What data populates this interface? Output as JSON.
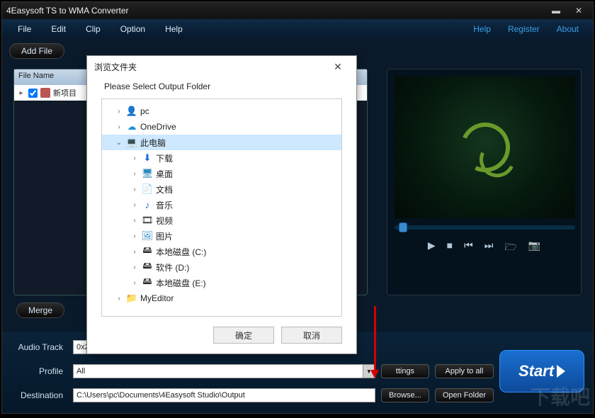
{
  "window": {
    "title": "4Easysoft TS to WMA Converter"
  },
  "menu": {
    "items": [
      "File",
      "Edit",
      "Clip",
      "Option",
      "Help"
    ],
    "right": [
      "Help",
      "Register",
      "About"
    ]
  },
  "toolbar": {
    "add_file": "Add File"
  },
  "file_list": {
    "header": "File Name",
    "item0_label": "新项目"
  },
  "buttons": {
    "merge": "Merge",
    "apply_all": "Apply to all",
    "browse": "Browse...",
    "open_folder": "Open Folder",
    "start": "Start",
    "settings_fragment": "ttings"
  },
  "labels": {
    "audio_track": "Audio Track",
    "profile": "Profile",
    "destination": "Destination"
  },
  "fields": {
    "audio_track_value": "0x2",
    "profile_value": "All",
    "destination_value": "C:\\Users\\pc\\Documents\\4Easysoft Studio\\Output"
  },
  "dialog": {
    "title": "浏览文件夹",
    "subtitle": "Please Select Output Folder",
    "ok": "确定",
    "cancel": "取消",
    "tree": {
      "n0": "pc",
      "n1": "OneDrive",
      "n2": "此电脑",
      "n3": "下载",
      "n4": "桌面",
      "n5": "文档",
      "n6": "音乐",
      "n7": "视频",
      "n8": "图片",
      "n9": "本地磁盘 (C:)",
      "n10": "软件 (D:)",
      "n11": "本地磁盘 (E:)",
      "n12": "MyEditor"
    }
  },
  "icons": {
    "user": "👤",
    "onedrive": "☁",
    "thispc": "💻",
    "downloads": "⬇",
    "desktop": "🖥",
    "documents": "📄",
    "music": "♪",
    "video": "🎞",
    "pictures": "🖼",
    "disk": "🖴",
    "folder": "📁"
  },
  "watermark": "下载吧"
}
